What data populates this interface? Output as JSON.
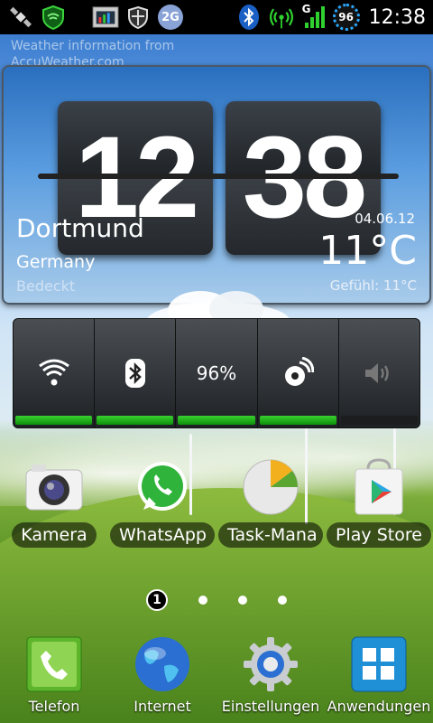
{
  "status_bar": {
    "icons": [
      "gps-satellite-icon",
      "shield-wifi-icon",
      "task-manager-icon",
      "security-shield-icon",
      "network-2g-icon",
      "bluetooth-icon",
      "wifi-hotspot-icon",
      "signal-icon"
    ],
    "network_tag": "2G",
    "signal_label": "G",
    "battery": "96",
    "time": "12:38"
  },
  "weather_widget": {
    "header_text": "Weather information from AccuWeather.com",
    "hour": "12",
    "minute": "38",
    "city": "Dortmund",
    "country": "Germany",
    "condition": "Bedeckt",
    "date": "04.06.12",
    "temperature": "11°C",
    "feels_like": "Gefühl: 11°C"
  },
  "power_widget": {
    "toggles": [
      {
        "name": "wifi",
        "icon": "wifi-icon",
        "on": true
      },
      {
        "name": "bluetooth",
        "icon": "bluetooth-icon",
        "on": true
      },
      {
        "name": "brightness",
        "label": "96%",
        "on": true
      },
      {
        "name": "sync",
        "icon": "sync-icon",
        "on": true
      },
      {
        "name": "sound",
        "icon": "speaker-icon",
        "on": false
      }
    ]
  },
  "apps": [
    {
      "label": "Kamera",
      "icon": "camera-icon"
    },
    {
      "label": "WhatsApp",
      "icon": "whatsapp-icon"
    },
    {
      "label": "Task-Mana",
      "icon": "task-manager-pie-icon"
    },
    {
      "label": "Play Store",
      "icon": "play-store-icon"
    }
  ],
  "pager": {
    "current": "1",
    "total": 4
  },
  "dock": [
    {
      "label": "Telefon",
      "icon": "phone-icon"
    },
    {
      "label": "Internet",
      "icon": "globe-icon"
    },
    {
      "label": "Einstellungen",
      "icon": "settings-gear-icon"
    },
    {
      "label": "Anwendungen",
      "icon": "app-grid-icon"
    }
  ],
  "colors": {
    "status_bar": "#000000",
    "toggle_on": "#1fae1a",
    "battery_ring": "#2aa8ff"
  }
}
